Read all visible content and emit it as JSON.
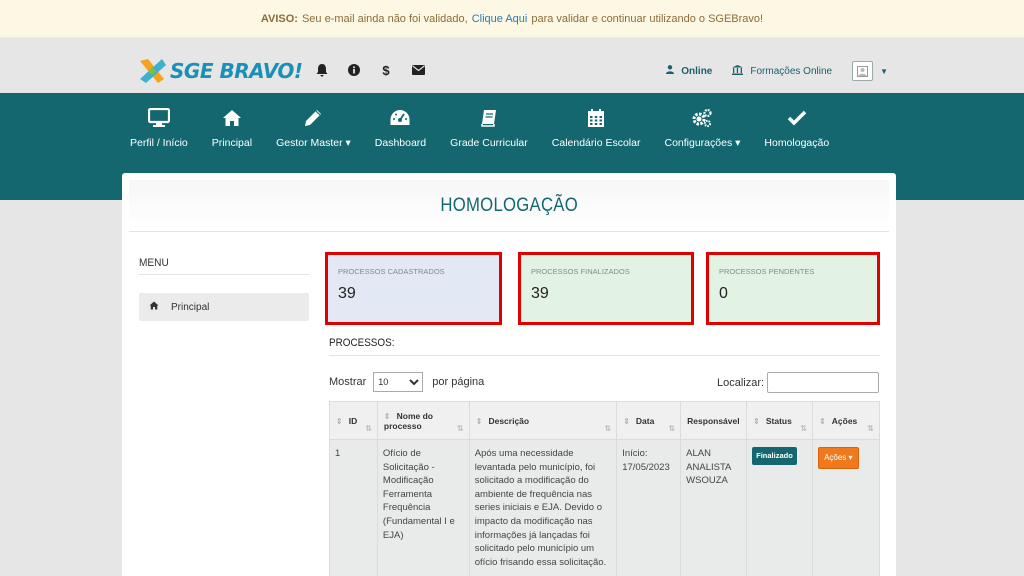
{
  "alert": {
    "prefix": "AVISO:",
    "message": "Seu e-mail ainda não foi validado,",
    "link": "Clique Aqui",
    "suffix": "para validar e continuar utilizando o SGEBravo!"
  },
  "brand": {
    "name": "SGE BRAVO!",
    "color": "#1b8fb5"
  },
  "top_icons": [
    "bell-icon",
    "info-icon",
    "dollar-icon",
    "envelope-icon"
  ],
  "user_menu": {
    "online": "Online",
    "formacoes": "Formações Online"
  },
  "nav": {
    "items": [
      {
        "label": "Perfil / Início",
        "icon": "monitor-icon"
      },
      {
        "label": "Principal",
        "icon": "home-icon"
      },
      {
        "label": "Gestor Master ▾",
        "icon": "pencil-icon"
      },
      {
        "label": "Dashboard",
        "icon": "dashboard-icon"
      },
      {
        "label": "Grade Curricular",
        "icon": "book-icon"
      },
      {
        "label": "Calendário Escolar",
        "icon": "calendar-icon"
      },
      {
        "label": "Configurações ▾",
        "icon": "cogs-icon"
      },
      {
        "label": "Homologação",
        "icon": "check-icon"
      }
    ],
    "bg_color": "#14676f"
  },
  "page": {
    "title": "HOMOLOGAÇÃO"
  },
  "sidebar": {
    "title": "MENU",
    "items": [
      {
        "label": "Principal"
      }
    ]
  },
  "stats": [
    {
      "label": "PROCESSOS CADASTRADOS",
      "value": "39"
    },
    {
      "label": "PROCESSOS FINALIZADOS",
      "value": "39"
    },
    {
      "label": "PROCESSOS PENDENTES",
      "value": "0"
    }
  ],
  "processos": {
    "title": "PROCESSOS:",
    "show_label": "Mostrar",
    "page_size": "10",
    "per_page_label": "por página",
    "search_label": "Localizar:",
    "columns": [
      "ID",
      "Nome do processo",
      "Descrição",
      "Data",
      "Responsável",
      "Status",
      "Ações"
    ],
    "rows": [
      {
        "id": "1",
        "nome": "Ofício de Solicitação - Modificação Ferramenta Frequência (Fundamental I e EJA)",
        "descricao": "Após uma necessidade levantada pelo município, foi solicitado a modificação do ambiente de frequência nas series iniciais e EJA. Devido o impacto da modificação nas informações já lançadas foi solicitado pelo município um ofício frisando essa solicitação.",
        "data": "Início: 17/05/2023",
        "responsavel": "ALAN ANALISTA WSOUZA",
        "status": "Finalizado",
        "acoes": "Ações ▾"
      }
    ]
  }
}
